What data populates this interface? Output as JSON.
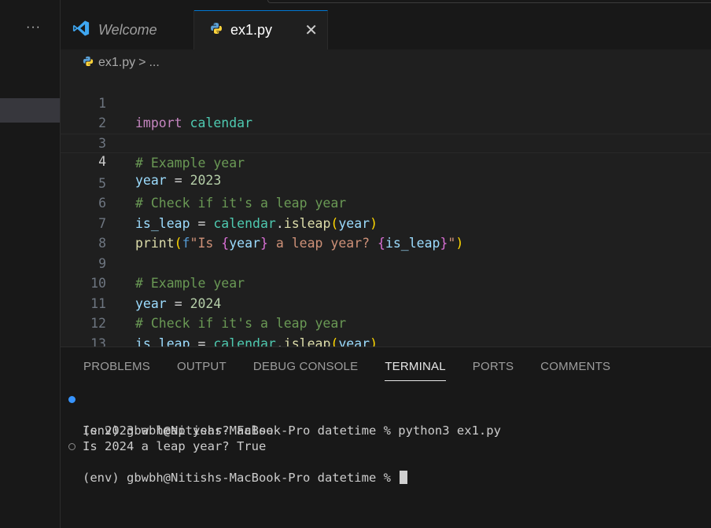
{
  "sidebar": {
    "more_label": "···"
  },
  "tabs": [
    {
      "label": "Welcome",
      "icon": "vscode-logo-icon"
    },
    {
      "label": "ex1.py",
      "icon": "python-file-icon",
      "close": "✕"
    }
  ],
  "breadcrumb": {
    "file": "ex1.py",
    "separator": ">",
    "rest": "..."
  },
  "code": {
    "line_numbers": [
      "1",
      "2",
      "3",
      "4",
      "5",
      "6",
      "7",
      "8",
      "9",
      "10",
      "11",
      "12",
      "13"
    ],
    "current_line": "4",
    "tokens": {
      "import_kw": "import",
      "calendar": "calendar",
      "comment_year": "# Example year",
      "year": "year",
      "eq": "=",
      "val_2023": "2023",
      "val_2024": "2024",
      "comment_check": "# Check if it's a leap year",
      "is_leap": "is_leap",
      "isleap": "isleap",
      "dot": ".",
      "lparen": "(",
      "rparen": ")",
      "print": "print",
      "f_prefix": "f",
      "str_open": "\"Is ",
      "lbrace": "{",
      "rbrace": "}",
      "str_mid": " a leap year? ",
      "str_close": "\""
    }
  },
  "panel": {
    "tabs": [
      "PROBLEMS",
      "OUTPUT",
      "DEBUG CONSOLE",
      "TERMINAL",
      "PORTS",
      "COMMENTS"
    ],
    "active_tab": "TERMINAL"
  },
  "terminal": {
    "lines": [
      "(env) gbwbh@Nitishs-MacBook-Pro datetime % python3 ex1.py",
      "Is 2023 a leap year? False",
      "Is 2024 a leap year? True",
      "(env) gbwbh@Nitishs-MacBook-Pro datetime % "
    ]
  },
  "colors": {
    "accent": "#0078d4",
    "keyword": "#c586c0",
    "comment": "#6a9955",
    "string": "#ce9178",
    "number": "#b5cea8",
    "variable": "#9cdcfe",
    "function": "#dcdcaa",
    "module": "#4ec9b0",
    "status_dot_success": "#3794ff"
  }
}
